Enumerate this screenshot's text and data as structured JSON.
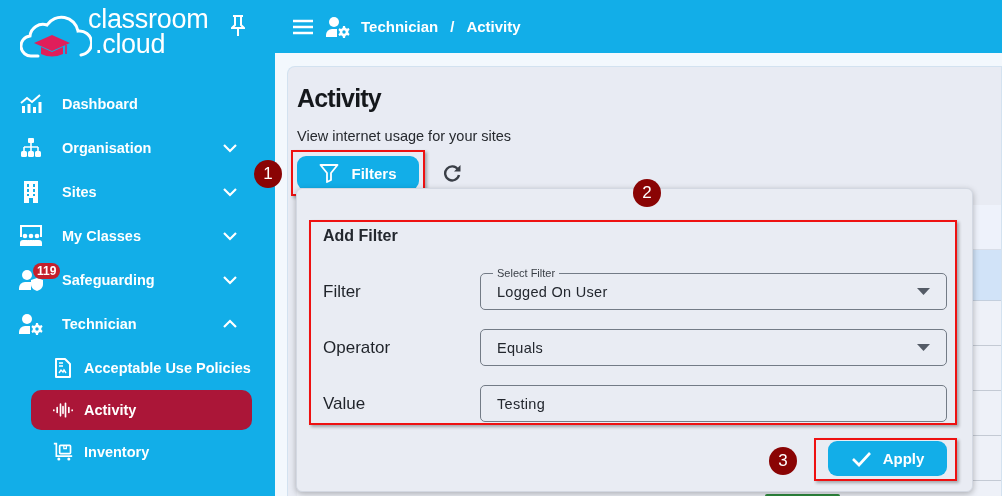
{
  "sidebar": {
    "logo": {
      "line_1": "classroom",
      "line_2": ".cloud"
    },
    "items": [
      {
        "label": "Dashboard",
        "kind": "link",
        "selected": false
      },
      {
        "label": "Organisation",
        "kind": "group",
        "expanded": false,
        "selected": false
      },
      {
        "label": "Sites",
        "kind": "group",
        "expanded": false,
        "selected": false
      },
      {
        "label": "My Classes",
        "kind": "group",
        "expanded": false,
        "selected": false
      },
      {
        "label": "Safeguarding",
        "kind": "group",
        "expanded": false,
        "selected": false,
        "badge": "119"
      },
      {
        "label": "Technician",
        "kind": "group",
        "expanded": true,
        "selected": false,
        "children": [
          {
            "label": "Acceptable Use Policies",
            "selected": false
          },
          {
            "label": "Activity",
            "selected": true
          },
          {
            "label": "Inventory",
            "selected": false
          }
        ]
      }
    ]
  },
  "top_bar": {
    "breadcrumb": [
      "Technician",
      "Activity"
    ],
    "separator": "/"
  },
  "page": {
    "title": "Activity",
    "subtitle": "View internet usage for your sites",
    "filters_button": "Filters"
  },
  "filter_panel": {
    "title": "Add Filter",
    "rows": [
      {
        "label": "Filter",
        "kind": "select",
        "floating_label": "Select Filter",
        "value": "Logged On User"
      },
      {
        "label": "Operator",
        "kind": "select",
        "value": "Equals"
      },
      {
        "label": "Value",
        "kind": "text",
        "value": "Testing"
      }
    ],
    "apply_button": "Apply"
  },
  "annotations": [
    {
      "number": "1"
    },
    {
      "number": "2"
    },
    {
      "number": "3"
    }
  ]
}
